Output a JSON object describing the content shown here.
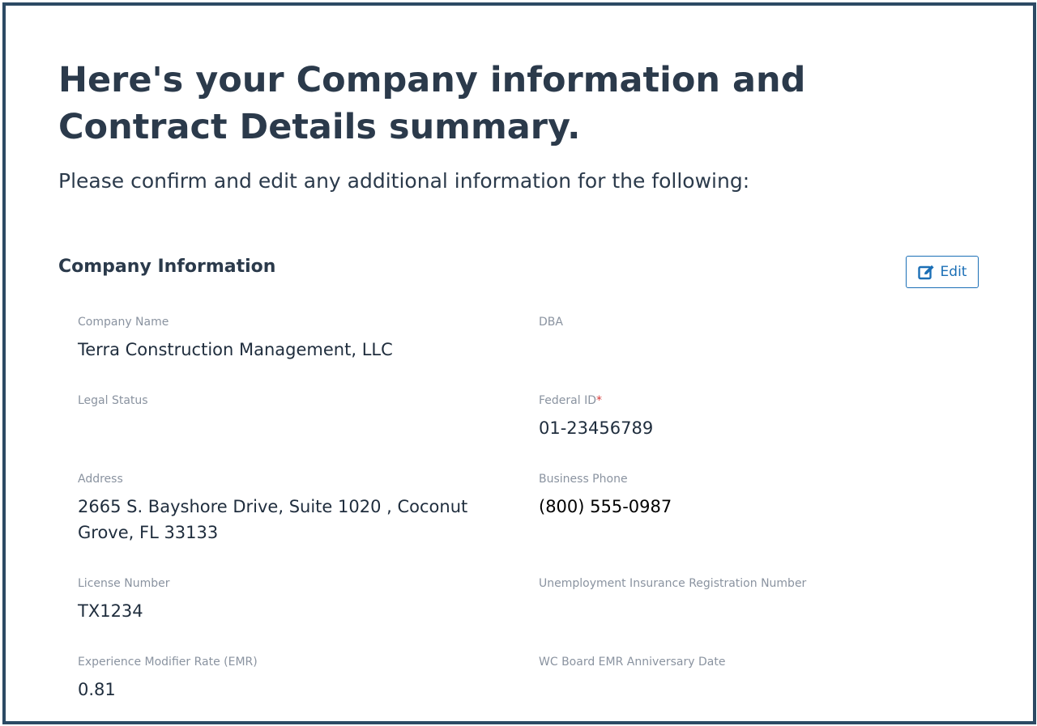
{
  "header": {
    "title": "Here's your Company information and Contract Details summary.",
    "subtitle": "Please confirm and edit any additional information for the following:"
  },
  "section": {
    "title": "Company Information",
    "edit_label": "Edit"
  },
  "fields": {
    "company_name": {
      "label": "Company Name",
      "value": "Terra Construction Management, LLC"
    },
    "dba": {
      "label": "DBA",
      "value": ""
    },
    "legal_status": {
      "label": "Legal Status",
      "value": ""
    },
    "federal_id": {
      "label": "Federal ID",
      "required_mark": "*",
      "value": "01-23456789"
    },
    "address": {
      "label": "Address",
      "value": "2665 S. Bayshore Drive, Suite 1020 , Coconut Grove, FL 33133"
    },
    "business_phone": {
      "label": "Business Phone",
      "value": "(800) 555-0987"
    },
    "license_number": {
      "label": "License Number",
      "value": "TX1234"
    },
    "unemployment_insurance": {
      "label": "Unemployment Insurance Registration Number",
      "value": ""
    },
    "emr": {
      "label": "Experience Modifier Rate (EMR)",
      "value": "0.81"
    },
    "wc_board_emr_date": {
      "label": "WC Board EMR Anniversary Date",
      "value": ""
    }
  },
  "colors": {
    "frame": "#2c4a64",
    "text": "#2b3a4b",
    "label": "#8a93a0",
    "accent": "#1b6fb6",
    "required": "#d63a3a"
  },
  "icons": {
    "edit": "edit-icon"
  }
}
